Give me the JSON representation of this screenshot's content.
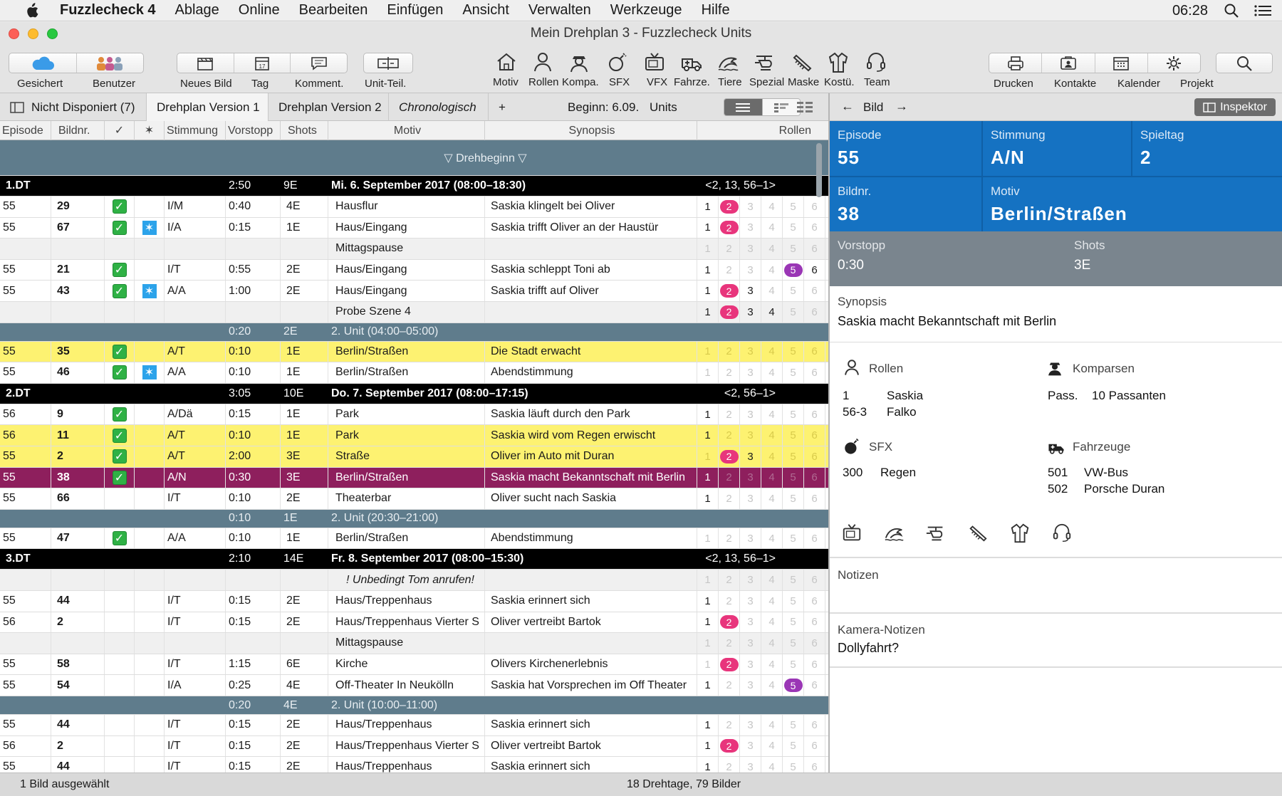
{
  "menubar": {
    "app_name": "Fuzzlecheck 4",
    "items": [
      "Ablage",
      "Online",
      "Bearbeiten",
      "Einfügen",
      "Ansicht",
      "Verwalten",
      "Werkzeuge",
      "Hilfe"
    ],
    "clock": "06:28"
  },
  "window": {
    "title": "Mein Drehplan 3 - Fuzzlecheck Units"
  },
  "toolbar": {
    "gesichert": "Gesichert",
    "benutzer": "Benutzer",
    "neues_bild": "Neues Bild",
    "tag": "Tag",
    "komment": "Komment.",
    "unit_teil": "Unit-Teil.",
    "categories": [
      "Motiv",
      "Rollen",
      "Kompa.",
      "SFX",
      "VFX",
      "Fahrze.",
      "Tiere",
      "Spezial",
      "Maske",
      "Kostü.",
      "Team"
    ],
    "drucken": "Drucken",
    "kontakte": "Kontakte",
    "kalender": "Kalender",
    "projekt": "Projekt"
  },
  "tabs": {
    "nicht_disponiert": "Nicht Disponiert (7)",
    "v1": "Drehplan Version 1",
    "v2": "Drehplan Version 2",
    "chrono": "Chronologisch",
    "plus": "+",
    "beginn": "Beginn: 6.09.",
    "units": "Units"
  },
  "columns": {
    "episode": "Episode",
    "bildnr": "Bildnr.",
    "check": "✓",
    "star": "✶",
    "stimmung": "Stimmung",
    "vorstopp": "Vorstopp",
    "shots": "Shots",
    "motiv": "Motiv",
    "synopsis": "Synopsis",
    "rollen": "Rollen"
  },
  "drehbeginn": "▽ Drehbeginn ▽",
  "rows": [
    {
      "t": "day",
      "label": "1.DT",
      "vorstopp": "2:50",
      "shots": "9E",
      "text": "Mi. 6. September 2017 (08:00–18:30)",
      "roles": "<2, 13, 56–1>"
    },
    {
      "t": "plain",
      "ep": "55",
      "nr": "29",
      "chk": true,
      "star": false,
      "st": "I/M",
      "vs": "0:40",
      "sh": "4E",
      "mo": "Hausflur",
      "sy": "Saskia klingelt bei Oliver",
      "r": [
        "1",
        "p2",
        "3d",
        "4d",
        "5d",
        "6d"
      ]
    },
    {
      "t": "plain",
      "ep": "55",
      "nr": "67",
      "chk": true,
      "star": true,
      "st": "I/A",
      "vs": "0:15",
      "sh": "1E",
      "mo": "Haus/Eingang",
      "sy": "Saskia trifft Oliver an der Haustür",
      "r": [
        "1",
        "p2",
        "3d",
        "4d",
        "5d",
        "6d"
      ]
    },
    {
      "t": "note",
      "mo": "Mittagspause",
      "r": [
        "1d",
        "2d",
        "3d",
        "4d",
        "5d",
        "6d"
      ]
    },
    {
      "t": "plain",
      "ep": "55",
      "nr": "21",
      "chk": true,
      "star": false,
      "st": "I/T",
      "vs": "0:55",
      "sh": "2E",
      "mo": "Haus/Eingang",
      "sy": "Saskia schleppt Toni ab",
      "r": [
        "1",
        "2d",
        "3d",
        "4d",
        "v5",
        "6"
      ]
    },
    {
      "t": "plain",
      "ep": "55",
      "nr": "43",
      "chk": true,
      "star": true,
      "st": "A/A",
      "vs": "1:00",
      "sh": "2E",
      "mo": "Haus/Eingang",
      "sy": "Saskia trifft auf Oliver",
      "r": [
        "1",
        "p2",
        "3",
        "4d",
        "5d",
        "6d"
      ]
    },
    {
      "t": "note",
      "mo": "Probe Szene 4",
      "r": [
        "1",
        "p2",
        "3",
        "4",
        "5d",
        "6d"
      ]
    },
    {
      "t": "unit",
      "vorstopp": "0:20",
      "shots": "2E",
      "text": "2. Unit (04:00–05:00)"
    },
    {
      "t": "yellow",
      "ep": "55",
      "nr": "35",
      "chk": true,
      "star": false,
      "st": "A/T",
      "vs": "0:10",
      "sh": "1E",
      "mo": "Berlin/Straßen",
      "sy": "Die Stadt erwacht",
      "r": [
        "1d",
        "2d",
        "3d",
        "4d",
        "5d",
        "6d"
      ]
    },
    {
      "t": "plain",
      "ep": "55",
      "nr": "46",
      "chk": true,
      "star": true,
      "st": "A/A",
      "vs": "0:10",
      "sh": "1E",
      "mo": "Berlin/Straßen",
      "sy": "Abendstimmung",
      "r": [
        "1d",
        "2d",
        "3d",
        "4d",
        "5d",
        "6d"
      ]
    },
    {
      "t": "day",
      "label": "2.DT",
      "vorstopp": "3:05",
      "shots": "10E",
      "text": "Do. 7. September 2017 (08:00–17:15)",
      "roles": "<2, 56–1>"
    },
    {
      "t": "plain",
      "ep": "56",
      "nr": "9",
      "chk": true,
      "star": false,
      "st": "A/Dä",
      "vs": "0:15",
      "sh": "1E",
      "mo": "Park",
      "sy": "Saskia läuft durch den Park",
      "r": [
        "1",
        "2d",
        "3d",
        "4d",
        "5d",
        "6d"
      ]
    },
    {
      "t": "yellow",
      "ep": "56",
      "nr": "11",
      "chk": true,
      "star": false,
      "st": "A/T",
      "vs": "0:10",
      "sh": "1E",
      "mo": "Park",
      "sy": "Saskia wird vom Regen erwischt",
      "r": [
        "1",
        "2d",
        "3d",
        "4d",
        "5d",
        "6d"
      ]
    },
    {
      "t": "yellow",
      "ep": "55",
      "nr": "2",
      "chk": true,
      "star": false,
      "st": "A/T",
      "vs": "2:00",
      "sh": "3E",
      "mo": "Straße",
      "sy": "Oliver im Auto mit Duran",
      "r": [
        "1d",
        "p2",
        "3",
        "4d",
        "5d",
        "6d"
      ]
    },
    {
      "t": "purple",
      "ep": "55",
      "nr": "38",
      "chk": true,
      "star": false,
      "st": "A/N",
      "vs": "0:30",
      "sh": "3E",
      "mo": "Berlin/Straßen",
      "sy": "Saskia macht Bekanntschaft mit Berlin",
      "r": [
        "1",
        "2d",
        "3d",
        "4d",
        "5d",
        "6d"
      ]
    },
    {
      "t": "plain",
      "ep": "55",
      "nr": "66",
      "chk": false,
      "star": false,
      "st": "I/T",
      "vs": "0:10",
      "sh": "2E",
      "mo": "Theaterbar",
      "sy": "Oliver sucht nach Saskia",
      "r": [
        "1",
        "2d",
        "3d",
        "4d",
        "5d",
        "6d"
      ]
    },
    {
      "t": "unit",
      "vorstopp": "0:10",
      "shots": "1E",
      "text": "2. Unit (20:30–21:00)"
    },
    {
      "t": "plain",
      "ep": "55",
      "nr": "47",
      "chk": true,
      "star": false,
      "st": "A/A",
      "vs": "0:10",
      "sh": "1E",
      "mo": "Berlin/Straßen",
      "sy": "Abendstimmung",
      "r": [
        "1d",
        "2d",
        "3d",
        "4d",
        "5d",
        "6d"
      ]
    },
    {
      "t": "day",
      "label": "3.DT",
      "vorstopp": "2:10",
      "shots": "14E",
      "text": "Fr. 8. September 2017 (08:00–15:30)",
      "roles": "<2, 13, 56–1>"
    },
    {
      "t": "note",
      "mo": "! Unbedingt Tom anrufen!",
      "italic": true,
      "r": [
        "1d",
        "2d",
        "3d",
        "4d",
        "5d",
        "6d"
      ]
    },
    {
      "t": "plain",
      "ep": "55",
      "nr": "44",
      "chk": false,
      "star": false,
      "st": "I/T",
      "vs": "0:15",
      "sh": "2E",
      "mo": "Haus/Treppenhaus",
      "sy": "Saskia erinnert sich",
      "r": [
        "1",
        "2d",
        "3d",
        "4d",
        "5d",
        "6d"
      ]
    },
    {
      "t": "plain",
      "ep": "56",
      "nr": "2",
      "chk": false,
      "star": false,
      "st": "I/T",
      "vs": "0:15",
      "sh": "2E",
      "mo": "Haus/Treppenhaus Vierter S",
      "sy": "Oliver vertreibt Bartok",
      "r": [
        "1",
        "p2",
        "3d",
        "4d",
        "5d",
        "6d"
      ]
    },
    {
      "t": "note",
      "mo": "Mittagspause",
      "r": [
        "1d",
        "2d",
        "3d",
        "4d",
        "5d",
        "6d"
      ]
    },
    {
      "t": "plain",
      "ep": "55",
      "nr": "58",
      "chk": false,
      "star": false,
      "st": "I/T",
      "vs": "1:15",
      "sh": "6E",
      "mo": "Kirche",
      "sy": "Olivers Kirchenerlebnis",
      "r": [
        "1d",
        "p2",
        "3d",
        "4d",
        "5d",
        "6d"
      ]
    },
    {
      "t": "plain",
      "ep": "55",
      "nr": "54",
      "chk": false,
      "star": false,
      "st": "I/A",
      "vs": "0:25",
      "sh": "4E",
      "mo": "Off-Theater In Neukölln",
      "sy": "Saskia hat Vorsprechen im Off Theater",
      "r": [
        "1",
        "2d",
        "3d",
        "4d",
        "v5",
        "6d"
      ]
    },
    {
      "t": "unit",
      "vorstopp": "0:20",
      "shots": "4E",
      "text": "2. Unit (10:00–11:00)"
    },
    {
      "t": "plain",
      "ep": "55",
      "nr": "44",
      "chk": false,
      "star": false,
      "st": "I/T",
      "vs": "0:15",
      "sh": "2E",
      "mo": "Haus/Treppenhaus",
      "sy": "Saskia erinnert sich",
      "r": [
        "1",
        "2d",
        "3d",
        "4d",
        "5d",
        "6d"
      ]
    },
    {
      "t": "plain",
      "ep": "56",
      "nr": "2",
      "chk": false,
      "star": false,
      "st": "I/T",
      "vs": "0:15",
      "sh": "2E",
      "mo": "Haus/Treppenhaus Vierter S",
      "sy": "Oliver vertreibt Bartok",
      "r": [
        "1",
        "p2",
        "3d",
        "4d",
        "5d",
        "6d"
      ]
    },
    {
      "t": "plain",
      "ep": "55",
      "nr": "44",
      "chk": false,
      "star": false,
      "st": "I/T",
      "vs": "0:15",
      "sh": "2E",
      "mo": "Haus/Treppenhaus",
      "sy": "Saskia erinnert sich",
      "r": [
        "1",
        "2d",
        "3d",
        "4d",
        "5d",
        "6d"
      ]
    }
  ],
  "status": {
    "left": "1 Bild ausgewählt",
    "center": "18 Drehtage, 79 Bilder"
  },
  "inspector": {
    "bild": "Bild",
    "inspektor_btn": "Inspektor",
    "episode_label": "Episode",
    "episode": "55",
    "stimmung_label": "Stimmung",
    "stimmung": "A/N",
    "spieltag_label": "Spieltag",
    "spieltag": "2",
    "bildnr_label": "Bildnr.",
    "bildnr": "38",
    "motiv_label": "Motiv",
    "motiv": "Berlin/Straßen",
    "vorstopp_label": "Vorstopp",
    "vorstopp": "0:30",
    "shots_label": "Shots",
    "shots": "3E",
    "synopsis_label": "Synopsis",
    "synopsis": "Saskia macht Bekanntschaft mit Berlin",
    "rollen_label": "Rollen",
    "rollen": [
      {
        "nr": "1",
        "name": "Saskia"
      },
      {
        "nr": "56-3",
        "name": "Falko"
      }
    ],
    "komparsen_label": "Komparsen",
    "komparsen": {
      "key": "Pass.",
      "val": "10 Passanten"
    },
    "sfx_label": "SFX",
    "sfx": {
      "nr": "300",
      "name": "Regen"
    },
    "fahrzeuge_label": "Fahrzeuge",
    "fahrzeuge": [
      {
        "nr": "501",
        "name": "VW-Bus"
      },
      {
        "nr": "502",
        "name": "Porsche Duran"
      }
    ],
    "notizen_label": "Notizen",
    "kamera_label": "Kamera-Notizen",
    "kamera": "Dollyfahrt?"
  },
  "colors": {
    "blue": "#1572c2",
    "yellow": "#fdf271",
    "purple": "#8e1f5d",
    "unit": "#5f7c8c",
    "pink": "#e8357c",
    "violet": "#9a36b5",
    "check": "#2fb145"
  }
}
